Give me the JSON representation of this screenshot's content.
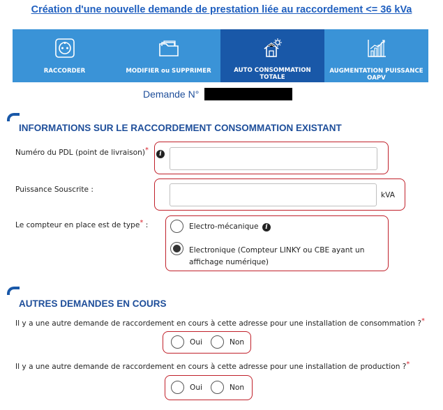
{
  "page_title": "Création d'une nouvelle demande de prestation liée au raccordement <= 36 kVa",
  "tabs": [
    {
      "label": "RACCORDER",
      "icon": "socket-icon",
      "active": false
    },
    {
      "label": "MODIFIER ou SUPPRIMER",
      "icon": "folder-icon",
      "active": false
    },
    {
      "label": "AUTO CONSOMMATION TOTALE",
      "icon": "solar-house-icon",
      "active": true
    },
    {
      "label": "AUGMENTATION PUISSANCE OAPV",
      "icon": "bar-chart-icon",
      "active": false
    }
  ],
  "demande": {
    "label": "Demande N°"
  },
  "section1": {
    "title": "INFORMATIONS SUR LE RACCORDEMENT CONSOMMATION EXISTANT",
    "pdl_label": "Numéro du PDL (point de livraison)",
    "pdl_value": "",
    "puissance_label": "Puissance Souscrite :",
    "puissance_value": "",
    "puissance_unit": "kVA",
    "compteur_label": "Le compteur en place est de type",
    "compteur_suffix": " :",
    "compteur_options": [
      {
        "label": "Electro-mécanique",
        "selected": false
      },
      {
        "label": "Electronique (Compteur LINKY ou CBE ayant un affichage numérique)",
        "selected": true
      }
    ]
  },
  "section2": {
    "title": "AUTRES DEMANDES EN COURS",
    "q1": "Il y a une autre demande de raccordement en cours à cette adresse pour une installation de consommation ?",
    "q2": "Il y a une autre demande de raccordement en cours à cette adresse pour une installation de production ?",
    "yes_label": "Oui",
    "no_label": "Non"
  },
  "required_mark": "*",
  "colors": {
    "accent": "#1958a8",
    "tab": "#3a93d7",
    "title": "#1f5fbf",
    "highlight": "#c0202a"
  }
}
